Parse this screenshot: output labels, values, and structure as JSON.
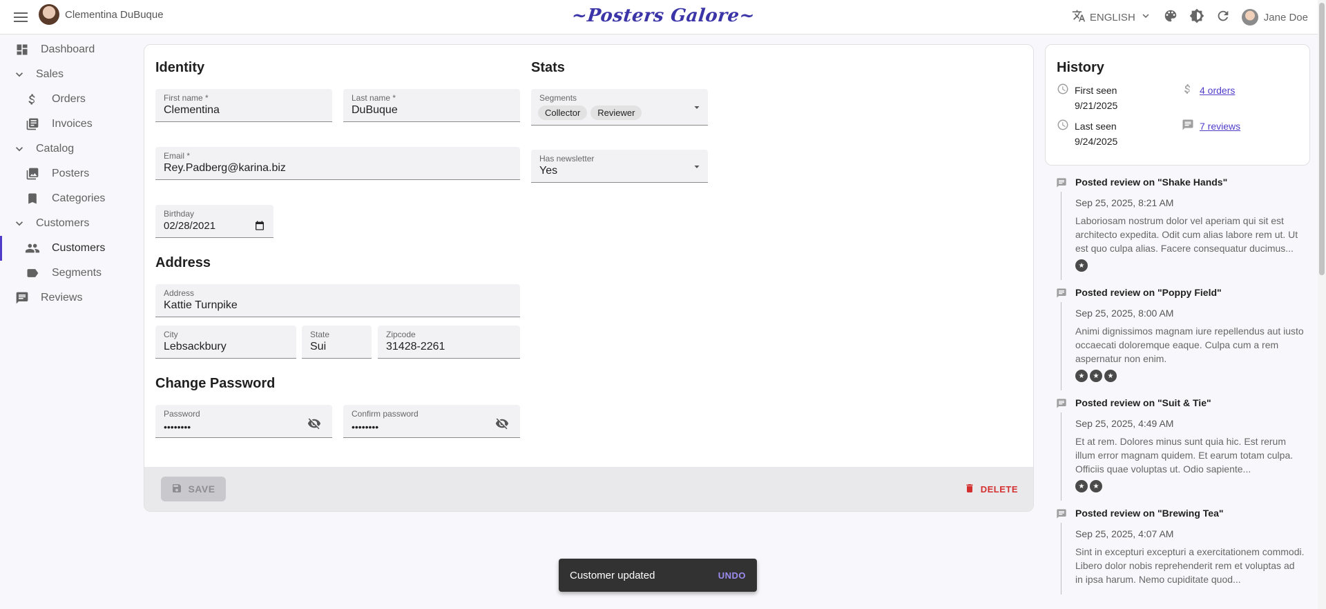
{
  "appbar": {
    "record_title": "Clementina DuBuque",
    "brand": "~Posters Galore~",
    "language": "ENGLISH",
    "user_name": "Jane Doe"
  },
  "sidebar": {
    "dashboard": "Dashboard",
    "sales": "Sales",
    "orders": "Orders",
    "invoices": "Invoices",
    "catalog": "Catalog",
    "posters": "Posters",
    "categories": "Categories",
    "customers_group": "Customers",
    "customers": "Customers",
    "segments": "Segments",
    "reviews": "Reviews",
    "active_color": "#4f3cc9"
  },
  "form": {
    "identity_title": "Identity",
    "stats_title": "Stats",
    "address_title": "Address",
    "password_title": "Change Password",
    "first_name": {
      "label": "First name *",
      "value": "Clementina"
    },
    "last_name": {
      "label": "Last name *",
      "value": "DuBuque"
    },
    "email": {
      "label": "Email *",
      "value": "Rey.Padberg@karina.biz"
    },
    "birthday": {
      "label": "Birthday",
      "value": "02/28/2021"
    },
    "segments": {
      "label": "Segments",
      "chips": [
        "Collector",
        "Reviewer"
      ]
    },
    "newsletter": {
      "label": "Has newsletter",
      "value": "Yes"
    },
    "address": {
      "label": "Address",
      "value": "Kattie Turnpike"
    },
    "city": {
      "label": "City",
      "value": "Lebsackbury"
    },
    "state": {
      "label": "State",
      "value": "Sui"
    },
    "zipcode": {
      "label": "Zipcode",
      "value": "31428-2261"
    },
    "password": {
      "label": "Password",
      "value": "••••••••"
    },
    "confirm_password": {
      "label": "Confirm password",
      "value": "••••••••"
    }
  },
  "toolbar": {
    "save_label": "SAVE",
    "delete_label": "DELETE"
  },
  "history": {
    "title": "History",
    "first_seen_label": "First seen",
    "first_seen_date": "9/21/2025",
    "last_seen_label": "Last seen",
    "last_seen_date": "9/24/2025",
    "orders_link": "4 orders",
    "reviews_link": "7 reviews"
  },
  "timeline": [
    {
      "title": "Posted review on \"Shake Hands\"",
      "date": "Sep 25, 2025, 8:21 AM",
      "body": "Laboriosam nostrum dolor vel aperiam qui sit est architecto expedita. Odit cum alias labore rem ut. Ut est quo culpa alias. Facere consequatur ducimus...",
      "rating": 1
    },
    {
      "title": "Posted review on \"Poppy Field\"",
      "date": "Sep 25, 2025, 8:00 AM",
      "body": "Animi dignissimos magnam iure repellendus aut iusto occaecati doloremque eaque. Culpa cum a rem aspernatur non enim.",
      "rating": 3
    },
    {
      "title": "Posted review on \"Suit & Tie\"",
      "date": "Sep 25, 2025, 4:49 AM",
      "body": "Et at rem. Dolores minus sunt quia hic. Est rerum illum error magnam quidem. Et earum totam culpa. Officiis quae voluptas ut. Odio sapiente...",
      "rating": 2
    },
    {
      "title": "Posted review on \"Brewing Tea\"",
      "date": "Sep 25, 2025, 4:07 AM",
      "body": "Sint in excepturi excepturi a exercitationem commodi. Libero dolor nobis reprehenderit rem et voluptas ad in ipsa harum. Nemo cupiditate quod...",
      "rating": 0
    }
  ],
  "snackbar": {
    "message": "Customer updated",
    "action": "UNDO"
  }
}
